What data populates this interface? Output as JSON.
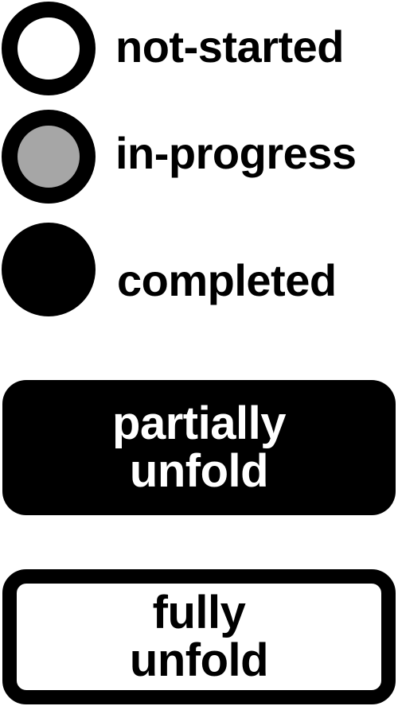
{
  "legend": {
    "items": [
      {
        "label": "not-started",
        "fill": "#ffffff"
      },
      {
        "label": "in-progress",
        "fill": "#a6a6a6"
      },
      {
        "label": "completed",
        "fill": "#000000"
      }
    ]
  },
  "buttons": {
    "partial": {
      "line1": "partially",
      "line2": "unfold",
      "background": "#000000",
      "text_color": "#ffffff"
    },
    "full": {
      "line1": "fully",
      "line2": "unfold",
      "background": "#ffffff",
      "text_color": "#000000"
    }
  }
}
